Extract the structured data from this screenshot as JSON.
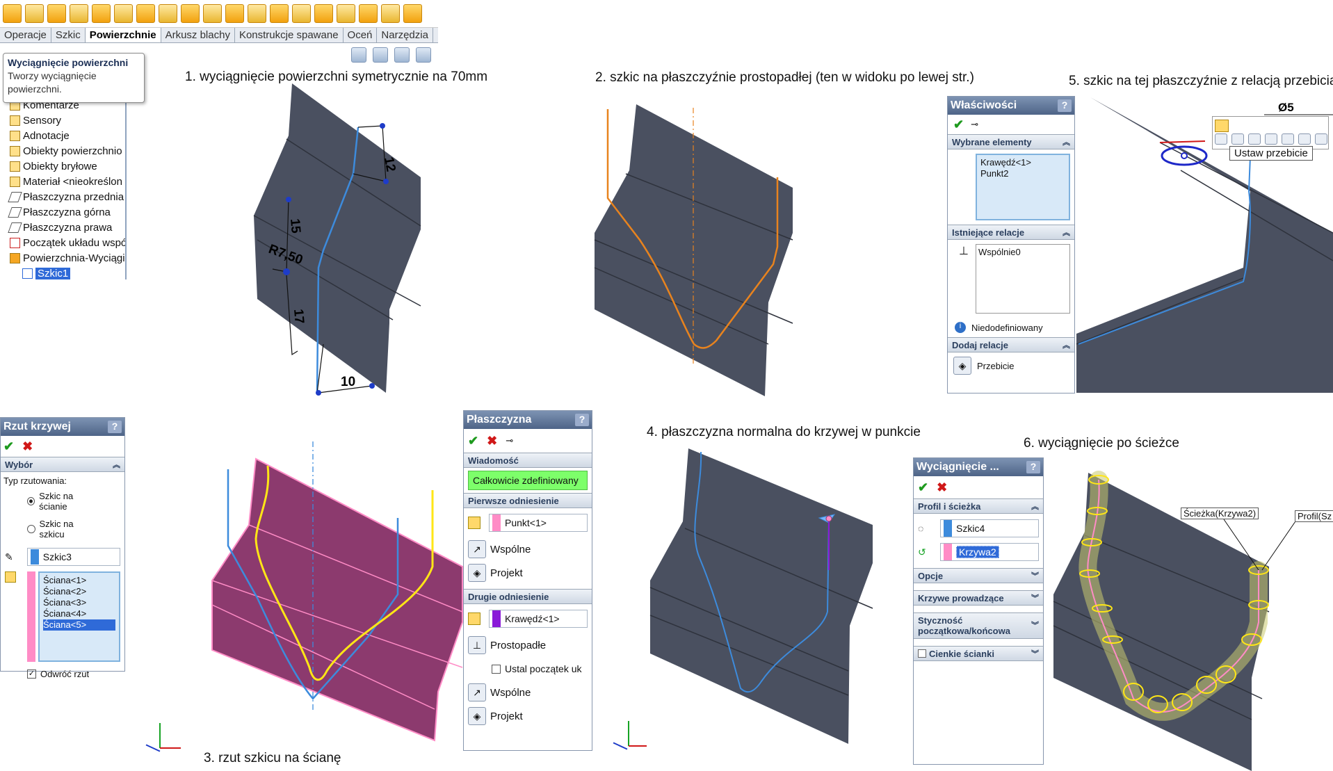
{
  "toolbar": {
    "tabs": [
      "Operacje",
      "Szkic",
      "Powierzchnie",
      "Arkusz blachy",
      "Konstrukcje spawane",
      "Oceń",
      "Narzędzia"
    ]
  },
  "tooltip": {
    "title": "Wyciągnięcie powierzchni",
    "text": "Tworzy wyciągnięcie powierzchni."
  },
  "tree": {
    "items": [
      {
        "label": "Komentarze",
        "icon": "comments-icon"
      },
      {
        "label": "Sensory",
        "icon": "sensors-icon"
      },
      {
        "label": "Adnotacje",
        "icon": "annotations-icon"
      },
      {
        "label": "Obiekty powierzchnio",
        "icon": "surface-bodies-icon"
      },
      {
        "label": "Obiekty bryłowe",
        "icon": "solid-bodies-icon"
      },
      {
        "label": "Materiał <nieokreślon",
        "icon": "material-icon"
      },
      {
        "label": "Płaszczyzna przednia",
        "icon": "plane-icon"
      },
      {
        "label": "Płaszczyzna górna",
        "icon": "plane-icon"
      },
      {
        "label": "Płaszczyzna prawa",
        "icon": "plane-icon"
      },
      {
        "label": "Początek układu wspó",
        "icon": "origin-icon"
      },
      {
        "label": "Powierzchnia-Wyciągi",
        "icon": "surface-extrude-icon"
      },
      {
        "label": "Szkic1",
        "icon": "sketch-icon"
      }
    ]
  },
  "captions": {
    "c1": "1. wyciągnięcie powierzchni symetrycznie na 70mm",
    "c2": "2. szkic na płaszczyźnie prostopadłej (ten w widoku po lewej str.)",
    "c3": "3. rzut szkicu na ścianę",
    "c4": "4. płaszczyzna normalna do krzywej w punkcie",
    "c5": "5. szkic na tej płaszczyźnie z relacją przebicia",
    "c6": "6. wyciągnięcie po ścieżce"
  },
  "dims": {
    "d12": "12",
    "d15": "15",
    "dr": "R7,50",
    "d17": "17",
    "d10": "10",
    "d5": "Ø5"
  },
  "wlasciwosci": {
    "title": "Właściwości",
    "sec_selected": "Wybrane elementy",
    "selected": [
      "Krawędź<1>",
      "Punkt2"
    ],
    "sec_existing": "Istniejące relacje",
    "existing": [
      "Wspólnie0"
    ],
    "status": "Niedodefiniowany",
    "sec_add": "Dodaj relacje",
    "add": [
      "Przebicie"
    ],
    "popup_tip": "Ustaw przebicie"
  },
  "rzut": {
    "title": "Rzut krzywej",
    "sec": "Wybór",
    "type_label": "Typ rzutowania:",
    "opt1": "Szkic na ścianie",
    "opt2": "Szkic na szkicu",
    "sketch": "Szkic3",
    "faces": [
      "Ściana<1>",
      "Ściana<2>",
      "Ściana<3>",
      "Ściana<4>",
      "Ściana<5>"
    ],
    "reverse": "Odwróć rzut"
  },
  "plaszczyzna": {
    "title": "Płaszczyzna",
    "sec_msg": "Wiadomość",
    "msg": "Całkowicie zdefiniowany",
    "sec_ref1": "Pierwsze odniesienie",
    "ref1": "Punkt<1>",
    "ref1_opts": [
      "Wspólne",
      "Projekt"
    ],
    "sec_ref2": "Drugie odniesienie",
    "ref2": "Krawędź<1>",
    "ref2_opts": [
      "Prostopadłe",
      "Ustal początek uk",
      "Wspólne",
      "Projekt"
    ]
  },
  "sweep": {
    "title": "Wyciągnięcie ...",
    "sec_profile": "Profil i ścieżka",
    "profile": "Szkic4",
    "path": "Krzywa2",
    "sec_opt": "Opcje",
    "sec_guides": "Krzywe prowadzące",
    "sec_tang": "Styczność początkowa/końcowa",
    "sec_thin": "Cienkie ścianki",
    "callout_path": "Ścieżka(Krzywa2)",
    "callout_profile": "Profil(Sz"
  },
  "colors": {
    "surface": "#4a5060",
    "sketch_blue": "#3d8bdc",
    "orange": "#e8831e",
    "magenta": "#8c3a6e",
    "accent_green": "#7dff6a"
  }
}
